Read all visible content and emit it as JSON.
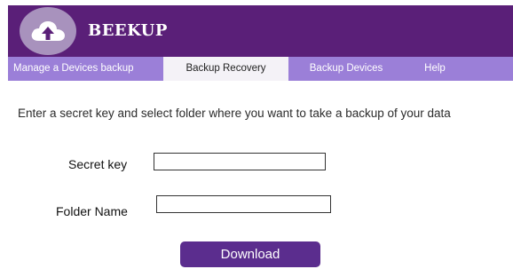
{
  "header": {
    "brand": "BEEKUP",
    "logo_icon": "cloud-upload-icon"
  },
  "tabs": [
    {
      "label": "Manage a Devices backup",
      "active": false
    },
    {
      "label": "Backup Recovery",
      "active": true
    },
    {
      "label": "Backup Devices",
      "active": false
    },
    {
      "label": "Help",
      "active": false
    }
  ],
  "main": {
    "instructions": "Enter a secret key and select folder where you want to take a backup of your data",
    "secret_key_label": "Secret key",
    "secret_key_value": "",
    "folder_name_label": "Folder Name",
    "folder_name_value": "",
    "download_label": "Download"
  },
  "colors": {
    "header_bg": "#5a1f78",
    "tab_bar_bg": "#9b7fd8",
    "active_tab_bg": "#f4f2f7",
    "button_bg": "#5b2d8e"
  }
}
